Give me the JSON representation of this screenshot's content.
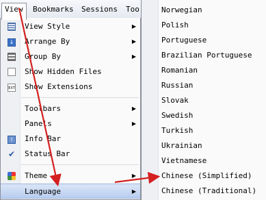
{
  "menubar": {
    "items": [
      {
        "label": "View"
      },
      {
        "label": "Bookmarks"
      },
      {
        "label": "Sessions"
      },
      {
        "label": "Too"
      }
    ]
  },
  "view_menu": {
    "items": [
      {
        "label": "View Style",
        "icon": "view-style-icon"
      },
      {
        "label": "Arrange By",
        "icon": "arrange-by-icon"
      },
      {
        "label": "Group By",
        "icon": "group-by-icon"
      },
      {
        "label": "Show Hidden Files",
        "icon": "hidden-files-icon"
      },
      {
        "label": "Show Extensions",
        "icon": "extensions-icon"
      },
      {
        "label": "Toolbars"
      },
      {
        "label": "Panels"
      },
      {
        "label": "Info Bar",
        "icon": "info-bar-icon"
      },
      {
        "label": "Status Bar",
        "icon": "checkmark-icon"
      },
      {
        "label": "Theme",
        "icon": "theme-icon"
      },
      {
        "label": "Language"
      }
    ]
  },
  "language_menu": {
    "items": [
      "Norwegian",
      "Polish",
      "Portuguese",
      "Brazilian Portuguese",
      "Romanian",
      "Russian",
      "Slovak",
      "Swedish",
      "Turkish",
      "Ukrainian",
      "Vietnamese",
      "Chinese (Simplified)",
      "Chinese (Traditional)"
    ]
  },
  "colors": {
    "annotation_arrow": "#d42020",
    "highlight": "#b8cdef"
  }
}
